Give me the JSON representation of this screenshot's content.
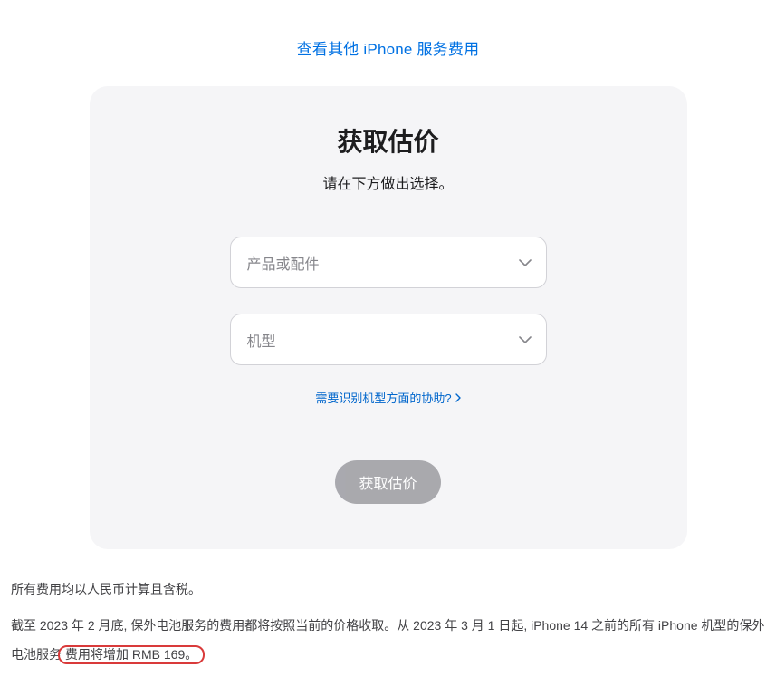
{
  "topLink": {
    "label": "查看其他 iPhone 服务费用"
  },
  "card": {
    "title": "获取估价",
    "subtitle": "请在下方做出选择。",
    "selectProduct": {
      "placeholder": "产品或配件"
    },
    "selectModel": {
      "placeholder": "机型"
    },
    "helpLink": {
      "label": "需要识别机型方面的协助?"
    },
    "submitButton": {
      "label": "获取估价"
    }
  },
  "footer": {
    "line1": "所有费用均以人民币计算且含税。",
    "line2_part1": "截至 2023 年 2 月底, 保外电池服务的费用都将按照当前的价格收取。从 2023 年 3 月 1 日起, iPhone 14 之前的所有 iPhone 机型的保外电池服务",
    "line2_highlight": "费用将增加 RMB 169。"
  }
}
